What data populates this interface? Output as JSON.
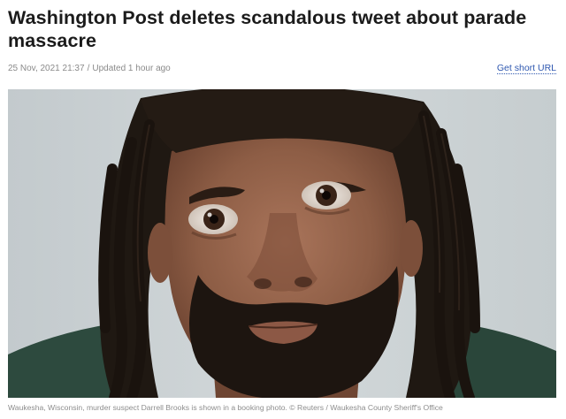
{
  "article": {
    "headline": "Washington Post deletes scandalous tweet about parade massacre",
    "published": "25 Nov, 2021 21:37",
    "separator": "/",
    "updated": "Updated 1 hour ago",
    "short_url_label": "Get short URL"
  },
  "photo": {
    "alt": "Booking photo of murder suspect Darrell Brooks",
    "caption": "Waukesha, Wisconsin, murder suspect Darrell Brooks is shown in a booking photo. © Reuters / Waukesha County Sheriff's Office"
  },
  "colors": {
    "link": "#2f58b0",
    "meta": "#8a8a8a",
    "headline": "#1b1b1b",
    "photo_background": "#c9d0d2"
  }
}
